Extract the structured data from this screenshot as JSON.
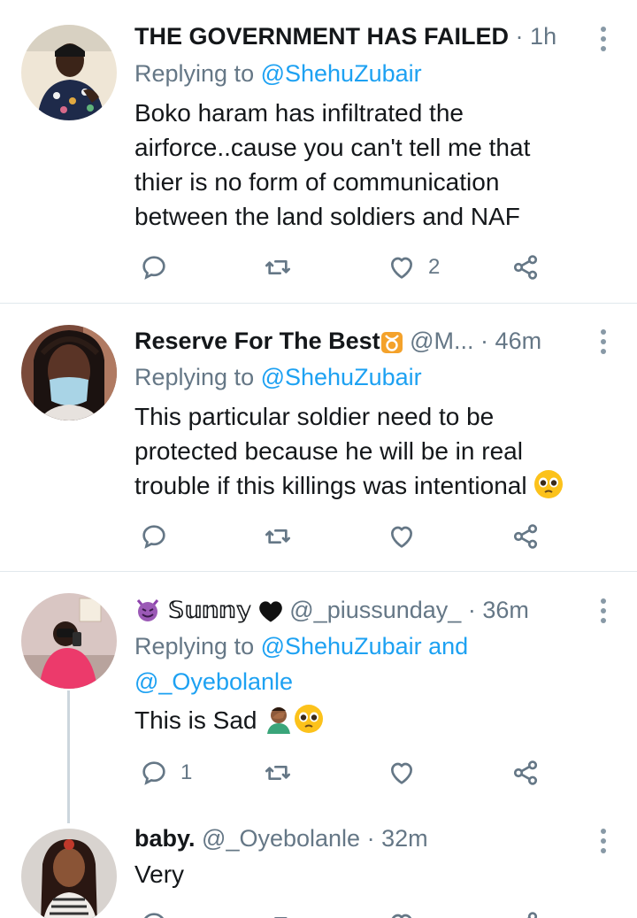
{
  "tweets": [
    {
      "name": "THE GOVERNMENT HAS FAILED",
      "handle": "",
      "time": "1h",
      "replying_prefix": "Replying to ",
      "replying_to": "@ShehuZubair",
      "lines": [
        "Boko haram has infiltrated the",
        "airforce..cause you can't tell me that",
        "thier is no form of communication",
        "between the land soldiers and  NAF"
      ],
      "reply_count": "",
      "retweet_count": "",
      "like_count": "2"
    },
    {
      "name": "Reserve For The Best",
      "name_emoji": "taurus-icon",
      "handle": "@M...",
      "time": "46m",
      "replying_prefix": "Replying to ",
      "replying_to": "@ShehuZubair",
      "lines": [
        "This particular soldier need to be",
        "protected because he will be in real",
        "trouble if this killings was intentional"
      ],
      "reply_count": "",
      "retweet_count": "",
      "like_count": ""
    },
    {
      "name": "𝕊𝕦𝕟𝕟𝕪",
      "handle": "@_piussunday_",
      "time": "36m",
      "replying_prefix": "Replying to ",
      "replying_to": "@ShehuZubair and",
      "replying_to_2": "@_Oyebolanle",
      "lines": [
        "This is Sad"
      ],
      "reply_count": "1",
      "retweet_count": "",
      "like_count": ""
    },
    {
      "name": "baby.",
      "handle": "@_Oyebolanle",
      "time": "32m",
      "lines": [
        "Very"
      ]
    }
  ],
  "colors": {
    "text": "#14171a",
    "secondary": "#657786",
    "link": "#1da1f2",
    "divider": "#e1e8ed"
  }
}
